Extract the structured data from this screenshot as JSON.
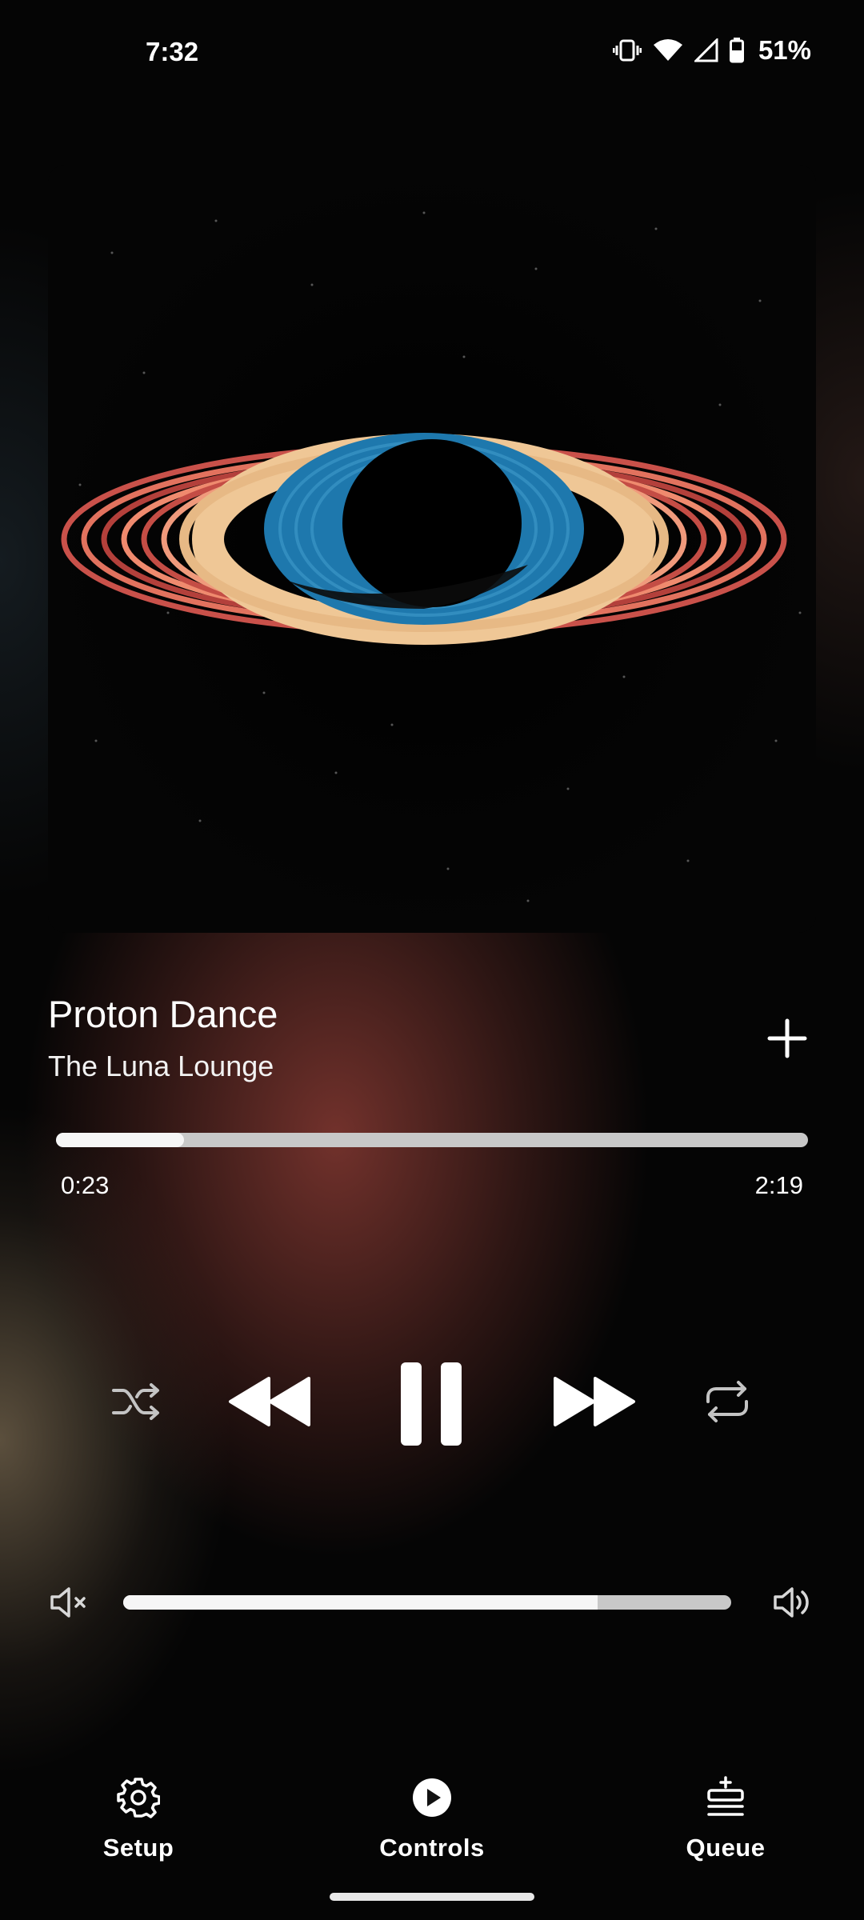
{
  "status_bar": {
    "time": "7:32",
    "battery": "51%"
  },
  "track": {
    "title": "Proton Dance",
    "artist": "The Luna Lounge"
  },
  "playback": {
    "elapsed": "0:23",
    "duration": "2:19",
    "progress": 0.17
  },
  "volume": {
    "level": 0.78
  },
  "controls": {
    "shuffle": "shuffle-icon",
    "rewind": "rewind-icon",
    "pause": "pause-icon",
    "fast_forward": "fast-forward-icon",
    "repeat": "repeat-icon"
  },
  "nav": [
    {
      "label": "Setup",
      "icon": "gear-icon"
    },
    {
      "label": "Controls",
      "icon": "play-circle-icon"
    },
    {
      "label": "Queue",
      "icon": "queue-add-icon"
    }
  ]
}
